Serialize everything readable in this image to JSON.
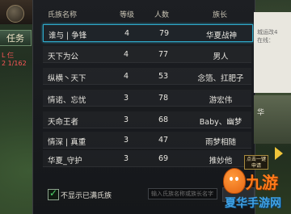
{
  "hud": {
    "task_label": "任务",
    "line1": "L 仨",
    "line2": "2 1/162"
  },
  "table": {
    "headers": [
      "氏族名称",
      "等级",
      "人数",
      "族长"
    ],
    "rows": [
      {
        "name": "谁与 | 争锋",
        "level": "4",
        "count": "79",
        "leader": "华夏战神",
        "selected": true
      },
      {
        "name": "天下为公",
        "level": "4",
        "count": "77",
        "leader": "男人",
        "selected": false
      },
      {
        "name": "纵横丶天下",
        "level": "4",
        "count": "53",
        "leader": "念箔、扛肥子",
        "selected": false
      },
      {
        "name": "情诺、忘忧",
        "level": "3",
        "count": "78",
        "leader": "游宏伟",
        "selected": false
      },
      {
        "name": "天命王者",
        "level": "3",
        "count": "68",
        "leader": "Baby、幽梦",
        "selected": false
      },
      {
        "name": "情深 | 真重",
        "level": "3",
        "count": "47",
        "leader": "雨梦相随",
        "selected": false
      },
      {
        "name": "华夏_守护",
        "level": "3",
        "count": "69",
        "leader": "推妙他",
        "selected": false
      }
    ]
  },
  "bottom": {
    "checkbox_label": "不显示已满氏族",
    "search_placeholder": "输入氏族名称或族长名字"
  },
  "right": {
    "line1": "城运改4",
    "line2": "在线：",
    "tag": "华"
  },
  "tooltip": "点击一键申请",
  "watermark": {
    "brand": "九游",
    "site": "夏华手游网"
  }
}
